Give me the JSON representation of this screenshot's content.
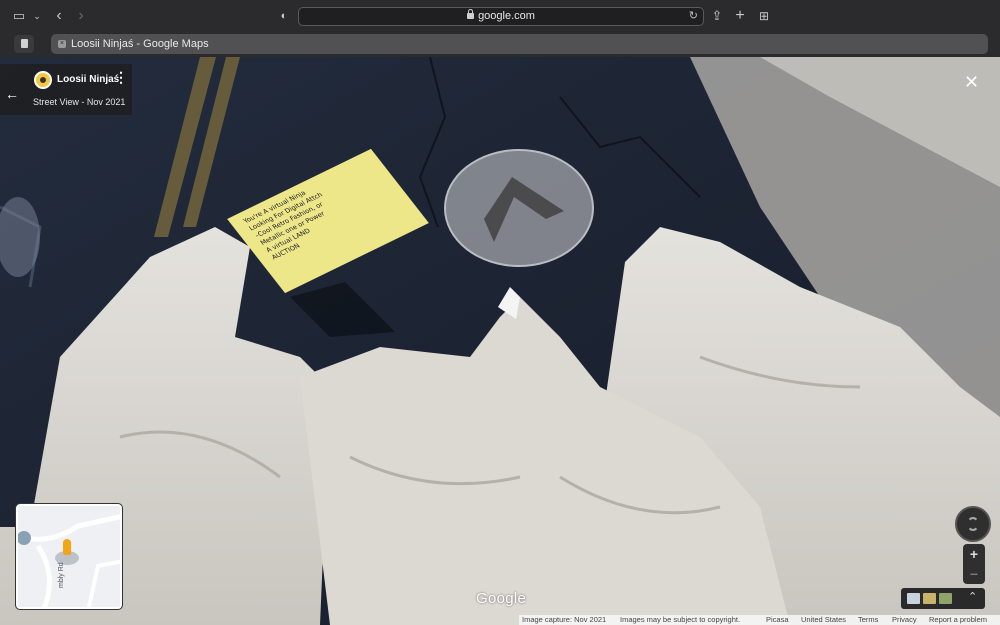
{
  "browser": {
    "url": "google.com",
    "tab_title": "Loosii Ninjaś - Google Maps"
  },
  "street_view": {
    "place_name": "Loosii Ninjaś",
    "date_label": "Street View - Nov 2021",
    "note_text": [
      "You're A virtual Ninja",
      "Looking For Digital Attch",
      "–Cool Retro Fashion, or",
      "Metallic one or Power",
      "A virtual LAND",
      "AUCTION"
    ],
    "map_road_label": "mbly Rd",
    "logo": "Google"
  },
  "footer": {
    "capture": "Image capture: Nov 2021",
    "copyright": "Images may be subject to copyright.",
    "picasa": "Picasa",
    "region": "United States",
    "terms": "Terms",
    "privacy": "Privacy",
    "report": "Report a problem"
  },
  "colors": {
    "chrome_bg": "#2b2b2d",
    "road": "#1d2535",
    "cloth": "#d9d6d1",
    "note": "#efe88a",
    "pegman": "#f2a516"
  },
  "icons": [
    "sidebar-icon",
    "chevron-down-icon",
    "back-icon",
    "forward-icon",
    "shield-icon",
    "lock-icon",
    "reload-icon",
    "share-icon",
    "plus-icon",
    "grid-icon",
    "page-icon",
    "close-icon",
    "arrow-left-icon",
    "more-icon",
    "navigation-arrow-icon",
    "pegman-icon",
    "compass-icon",
    "expand-icon"
  ]
}
